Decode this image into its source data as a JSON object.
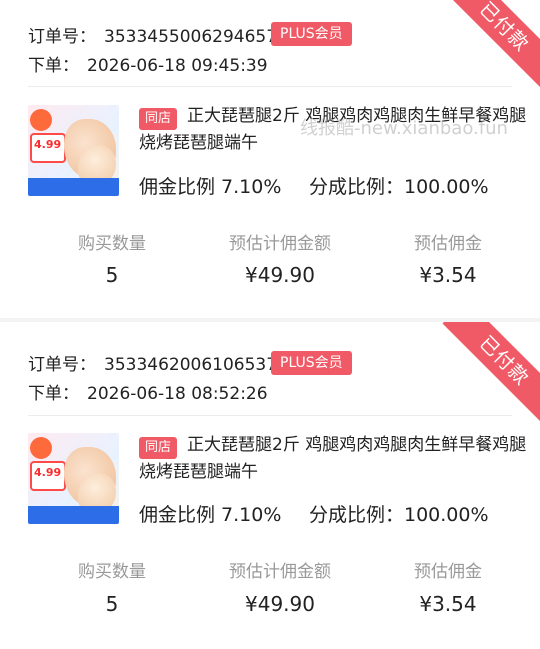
{
  "orders": [
    {
      "status": "已付款",
      "order_no_label": "订单号：",
      "order_no": "3533455006294657",
      "member_badge": "PLUS会员",
      "time_label": "下单：",
      "time": "2026-06-18 09:45:39",
      "thumb_price": "4.99",
      "store_badge": "同店",
      "product_title": "正大琵琶腿2斤 鸡腿鸡肉鸡腿肉生鲜早餐鸡腿烧烤琵琶腿端午",
      "commission_rate": "佣金比例 7.10%",
      "share_rate": "分成比例：100.00%",
      "stats": [
        {
          "label": "购买数量",
          "value": "5"
        },
        {
          "label": "预估计佣金额",
          "value": "¥49.90"
        },
        {
          "label": "预估佣金",
          "value": "¥3.54"
        }
      ]
    },
    {
      "status": "已付款",
      "order_no_label": "订单号：",
      "order_no": "3533462006106537",
      "member_badge": "PLUS会员",
      "time_label": "下单：",
      "time": "2026-06-18 08:52:26",
      "thumb_price": "4.99",
      "store_badge": "同店",
      "product_title": "正大琵琶腿2斤 鸡腿鸡肉鸡腿肉生鲜早餐鸡腿烧烤琵琶腿端午",
      "commission_rate": "佣金比例 7.10%",
      "share_rate": "分成比例：100.00%",
      "stats": [
        {
          "label": "购买数量",
          "value": "5"
        },
        {
          "label": "预估计佣金额",
          "value": "¥49.90"
        },
        {
          "label": "预估佣金",
          "value": "¥3.54"
        }
      ]
    }
  ],
  "watermark": "线报酷-new.xianbao.fun"
}
